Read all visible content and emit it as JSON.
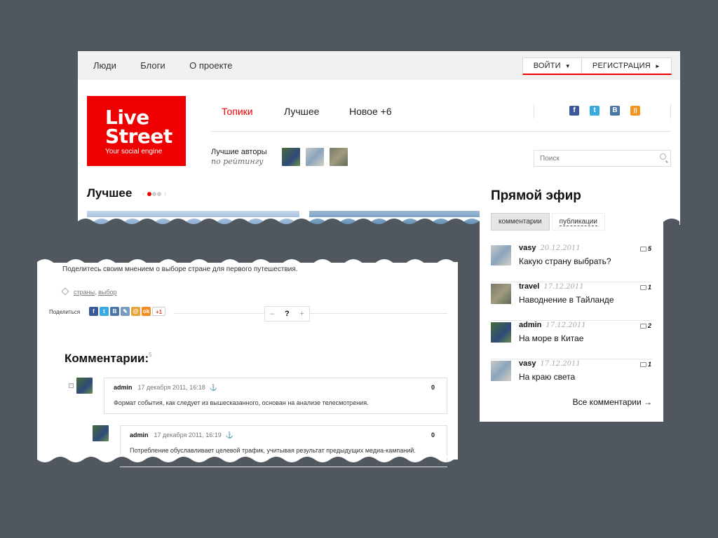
{
  "topbar": {
    "nav": [
      "Люди",
      "Блоги",
      "О проекте"
    ],
    "login": "ВОЙТИ",
    "login_arrow": "▼",
    "register": "РЕГИСТРАЦИЯ",
    "register_arrow": "►"
  },
  "logo": {
    "line1": "Live",
    "line2": "Street",
    "tagline": "Your social engine"
  },
  "mainnav": {
    "topics": "Топики",
    "best": "Лучшее",
    "new": "Новое +6"
  },
  "social": [
    {
      "name": "facebook-icon",
      "glyph": "f",
      "color": "#3b5998"
    },
    {
      "name": "twitter-icon",
      "glyph": "t",
      "color": "#39a9e0"
    },
    {
      "name": "vkontakte-icon",
      "glyph": "B",
      "color": "#4a76a8"
    },
    {
      "name": "rss-icon",
      "glyph": "))",
      "color": "#f49520"
    }
  ],
  "best_authors": {
    "title": "Лучшие авторы",
    "subtitle": "по рейтингу"
  },
  "search": {
    "placeholder": "Поиск"
  },
  "best_section": {
    "title": "Лучшее"
  },
  "article": {
    "description": "Поделитесь своим мнением о выборе стране для первого путешествия.",
    "tags": [
      "страны",
      "выбор"
    ],
    "share_label": "Поделиться",
    "vote": {
      "minus": "–",
      "value": "?",
      "plus": "+"
    }
  },
  "comments": {
    "title": "Комментарии:",
    "count": "5",
    "items": [
      {
        "author": "admin",
        "date": "17 декабря 2011, 16:18",
        "anchor": "⚓",
        "score": "0",
        "text": "Формат события, как следует из вышесказанного, основан на анализе телесмотрения."
      },
      {
        "author": "admin",
        "date": "17 декабря 2011, 16:19",
        "anchor": "⚓",
        "score": "0",
        "text": "Потребление обуславливает целевой трафик, учитывая результат предыдущих медиа-кампаний."
      }
    ]
  },
  "live": {
    "title": "Прямой эфир",
    "tabs": [
      "комментарии",
      "публикации"
    ],
    "items": [
      {
        "user": "vasy",
        "date": "20.12.2011",
        "title": "Какую страну выбрать?",
        "count": "5"
      },
      {
        "user": "travel",
        "date": "17.12.2011",
        "title": "Наводнение в Тайланде",
        "count": "1"
      },
      {
        "user": "admin",
        "date": "17.12.2011",
        "title": "На море в Китае",
        "count": "2"
      },
      {
        "user": "vasy",
        "date": "17.12.2011",
        "title": "На краю света",
        "count": "1"
      }
    ],
    "all_comments": "Все комментарии →"
  }
}
